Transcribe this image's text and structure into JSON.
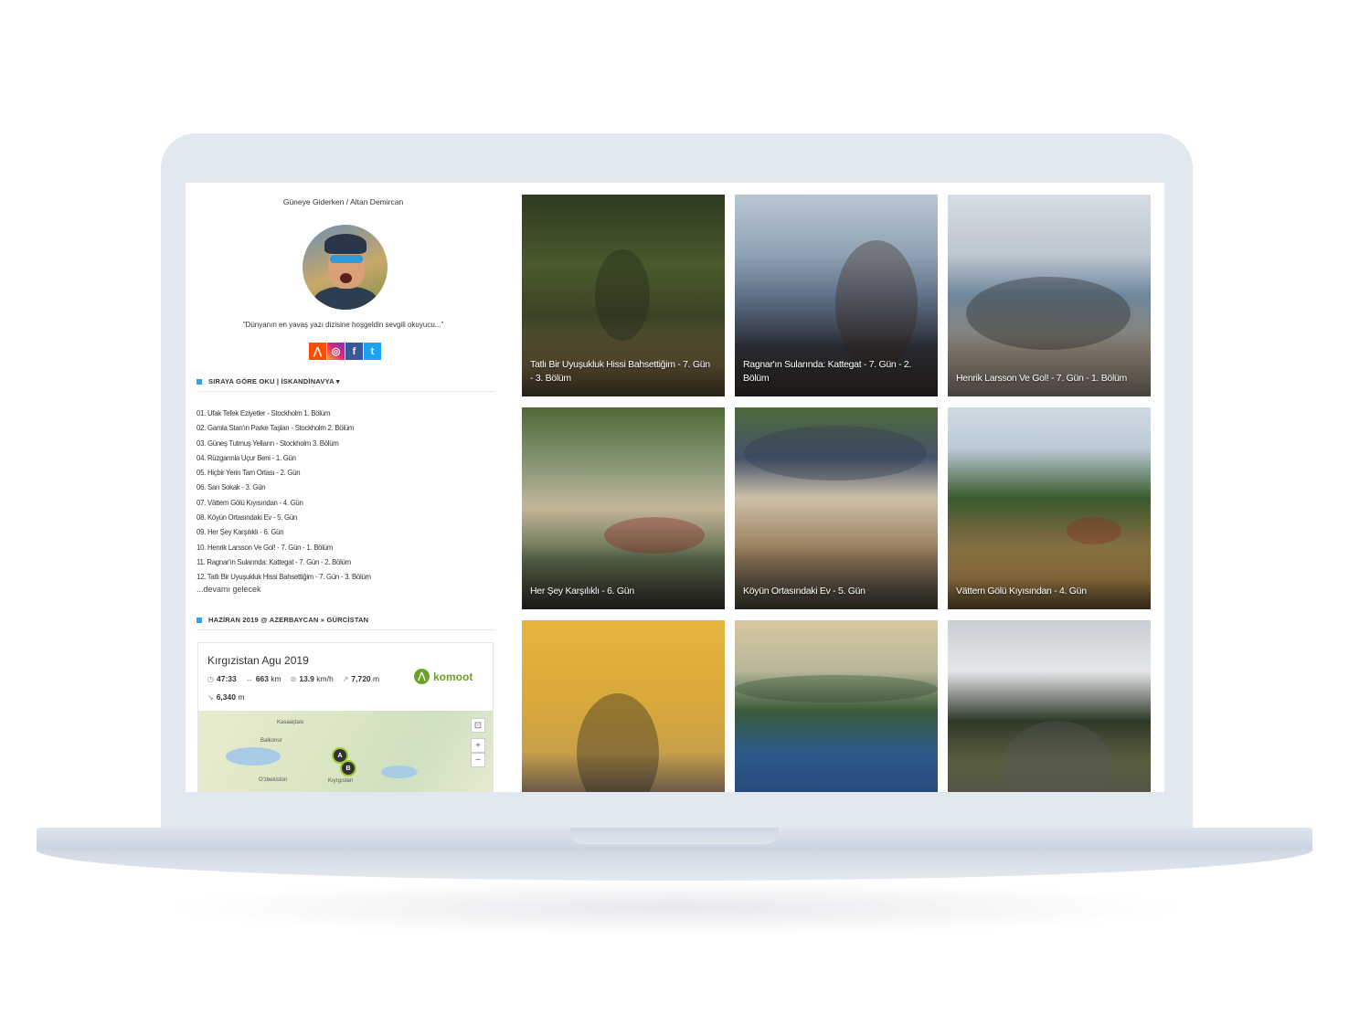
{
  "site": {
    "title": "Güneye Giderken / Altan Demircan",
    "quote": "\"Dünyanın en yavaş yazı dizisine hoşgeldin sevgili okuyucu...\"",
    "socials": [
      {
        "name": "strava-icon",
        "glyph": "⋀"
      },
      {
        "name": "instagram-icon",
        "glyph": "◎"
      },
      {
        "name": "facebook-icon",
        "glyph": "f"
      },
      {
        "name": "twitter-icon",
        "glyph": "t"
      }
    ]
  },
  "series": {
    "heading": "SIRAYA GÖRE OKU | İSKANDİNAVYA ▾",
    "posts": [
      "01. Ufak Tefek Eziyetler - Stockholm 1. Bölüm",
      "02. Gamla Stan'ın Parke Taşları - Stockholm 2. Bölüm",
      "03. Güneş Tutmuş Yelların - Stockholm 3. Bölüm",
      "04. Rüzgarınla Uçur Beni - 1. Gün",
      "05. Hiçbir Yerin Tam Ortası - 2. Gün",
      "06. Sarı Sokak - 3. Gün",
      "07. Vättern Gölü Kıyısından - 4. Gün",
      "08. Köyün Ortasındaki Ev - 5. Gün",
      "09. Her Şey Karşılıklı - 6. Gün",
      "10. Henrik Larsson Ve Gol! - 7. Gün - 1. Bölüm",
      "11. Ragnar'ın Sularında: Kattegat - 7. Gün - 2. Bölüm",
      "12. Tatlı Bir Uyuşukluk Hissi Bahsettiğim - 7. Gün - 3. Bölüm"
    ],
    "more": "...devamı gelecek"
  },
  "trip": {
    "heading": "HAZİRAN 2019 @ AZERBAYCAN » GÜRCİSTAN"
  },
  "komoot": {
    "title": "Kırgızistan Agu 2019",
    "brand": "komoot",
    "duration": "47:33",
    "distance": "663",
    "distance_unit": "km",
    "speed": "13.9",
    "speed_unit": "km/h",
    "ascent": "7,720",
    "ascent_unit": "m",
    "descent": "6,340",
    "descent_unit": "m",
    "map_labels": [
      "Kasaaçtası",
      "Balkonur",
      "O'zbekiston",
      "Kıyrgıstan"
    ],
    "pin_a": "A",
    "pin_b": "B",
    "zoom_in": "+",
    "zoom_out": "−",
    "recenter": "⊡"
  },
  "gallery": [
    {
      "caption": "Tatlı Bir Uyuşukluk Hissi Bahsettiğim - 7. Gün - 3. Bölüm"
    },
    {
      "caption": "Ragnar'ın Sularında: Kattegat - 7. Gün - 2. Bölüm"
    },
    {
      "caption": "Henrik Larsson Ve Gol! - 7. Gün - 1. Bölüm"
    },
    {
      "caption": "Her Şey Karşılıklı - 6. Gün"
    },
    {
      "caption": "Köyün Ortasındaki Ev - 5. Gün"
    },
    {
      "caption": "Vättern Gölü Kıyısından - 4. Gün"
    },
    {
      "caption": ""
    },
    {
      "caption": ""
    },
    {
      "caption": ""
    }
  ],
  "colors": {
    "accent": "#2ea3e6",
    "komoot_green": "#6aa127",
    "laptop": "#e2e8f0"
  }
}
